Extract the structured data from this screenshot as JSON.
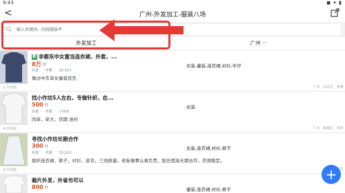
{
  "status": {
    "time": "9:43",
    "icons": "◼ ▾ ▮"
  },
  "header": {
    "back": "<",
    "title": "广州-外发加工-服装八场"
  },
  "search": {
    "placeholder": "输入关键词、向找服装平"
  },
  "tabs": [
    {
      "label": "外发加工"
    },
    {
      "label": "广州 ···"
    }
  ],
  "listings": [
    {
      "badge": "新",
      "title": "非都东中女童当连衣裙，外套，...",
      "price": "8万",
      "unit": "件",
      "tags": [
        "外发",
        "不限",
        "20-30人"
      ],
      "desc": "做过中东单女童装优先",
      "category": "女装,童装,连衣裙,衬衫,牛仔",
      "time": "1小时前",
      "location": "广州 · 白云区 · 某某"
    },
    {
      "badge": "",
      "title": "找小作坊5人左右，专做针织，在...",
      "price": "500",
      "unit": "件",
      "tags": [
        "外发",
        "不限",
        "小作坊"
      ],
      "desc": "同单，单大，货期 准时",
      "category": "女装",
      "time": "4小时前",
      "location": "广州 · 番禺区 · 南村"
    },
    {
      "badge": "",
      "title": "寻找小作坊长期合作",
      "price": "300",
      "unit": "件",
      "tags": [
        "外发",
        "不限",
        "10-20人"
      ],
      "desc": "梭织连衣裙、裤子，衬衫，皮衣，三线质量，老板做事认真负责，配合度高长期合作，货源稳定。",
      "category": "女装,连衣裙,衬衫,裤子",
      "time": "5小时前",
      "location": "广州 · 海珠区"
    },
    {
      "badge": "",
      "title": "裁片外发，外省也可以",
      "price": "800",
      "unit": "件",
      "tags": [],
      "desc": "",
      "category": "童装,连衣裙,衬衫,裤子",
      "time": "",
      "location": ""
    }
  ],
  "fab": {
    "label": "+"
  },
  "colors": {
    "accent": "#e53935",
    "price": "#e24a1c",
    "fab": "#2f7cf6"
  }
}
